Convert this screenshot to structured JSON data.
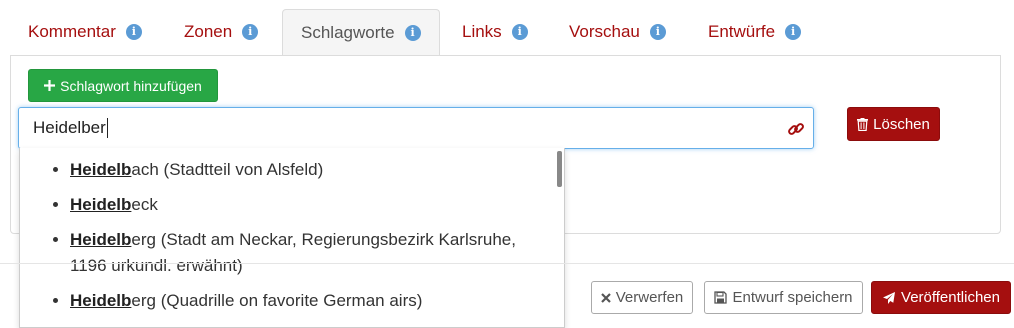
{
  "tabs": [
    {
      "label": "Kommentar",
      "active": false
    },
    {
      "label": "Zonen",
      "active": false
    },
    {
      "label": "Schlagworte",
      "active": true
    },
    {
      "label": "Links",
      "active": false
    },
    {
      "label": "Vorschau",
      "active": false
    },
    {
      "label": "Entwürfe",
      "active": false
    }
  ],
  "icons": {
    "info": "info-icon",
    "plus": "plus-icon",
    "link": "link-icon",
    "trash": "trash-icon",
    "times": "times-icon",
    "save": "floppy-disk-icon",
    "send": "paper-plane-icon"
  },
  "panel": {
    "add_button_label": "Schlagwort hinzufügen",
    "search_value": "Heidelber",
    "delete_button_label": "Löschen"
  },
  "suggestions": [
    {
      "match": "Heidelb",
      "rest": "ach (Stadtteil von Alsfeld)"
    },
    {
      "match": "Heidelb",
      "rest": "eck"
    },
    {
      "match": "Heidelb",
      "rest": "erg (Stadt am Neckar, Regierungsbezirk Karlsruhe, 1196 urkundl. erwähnt)"
    },
    {
      "match": "Heidelb",
      "rest": "erg (Quadrille on favorite German airs)"
    }
  ],
  "footer": {
    "discard_label": "Verwerfen",
    "save_label": "Entwurf speichern",
    "publish_label": "Veröffentlichen"
  },
  "colors": {
    "accent_red": "#a50f0f",
    "add_green": "#28a745",
    "info_blue": "#5b9bd5",
    "focus_blue": "#66afe9"
  }
}
